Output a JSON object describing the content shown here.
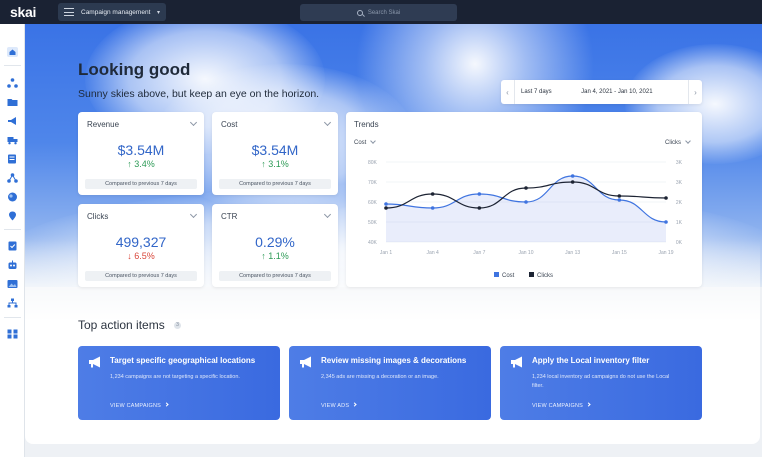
{
  "topbar": {
    "logo": "skai",
    "nav_label": "Campaign management",
    "search_placeholder": "Search Skai"
  },
  "hero": {
    "headline": "Looking good",
    "subhead": "Sunny skies above, but keep an eye on the horizon."
  },
  "datepicker": {
    "range_label": "Last 7 days",
    "dates": "Jan 4, 2021 - Jan 10, 2021"
  },
  "kpis": [
    {
      "title": "Revenue",
      "value": "$3.54M",
      "delta": "3.4%",
      "direction": "up",
      "footer": "Compared to previous 7 days"
    },
    {
      "title": "Cost",
      "value": "$3.54M",
      "delta": "3.1%",
      "direction": "up",
      "footer": "Compared to previous 7 days"
    },
    {
      "title": "Clicks",
      "value": "499,327",
      "delta": "6.5%",
      "direction": "down",
      "footer": "Compared to previous 7 days"
    },
    {
      "title": "CTR",
      "value": "0.29%",
      "delta": "1.1%",
      "direction": "up",
      "footer": "Compared to previous 7 days"
    }
  ],
  "trends": {
    "title": "Trends",
    "left_metric": "Cost",
    "right_metric": "Clicks"
  },
  "chart_data": {
    "type": "line",
    "x": [
      "Jan 1",
      "Jan 4",
      "Jan 7",
      "Jan 10",
      "Jan 13",
      "Jan 15",
      "Jan 19"
    ],
    "y_left_ticks": [
      "80K",
      "70K",
      "60K",
      "50K",
      "40K"
    ],
    "y_right_ticks": [
      "3K",
      "3K",
      "2K",
      "1K",
      "0K"
    ],
    "ylim_left": [
      40,
      80
    ],
    "series": [
      {
        "name": "Cost",
        "axis": "left",
        "color": "#3f74e0",
        "area": true,
        "values": [
          59,
          57,
          64,
          60,
          73,
          61,
          50
        ]
      },
      {
        "name": "Clicks",
        "axis": "left",
        "color": "#1c2333",
        "area": false,
        "values": [
          57,
          64,
          57,
          67,
          70,
          63,
          62
        ]
      }
    ],
    "legend_position": "bottom",
    "grid": true
  },
  "actions": {
    "title": "Top action items",
    "count": "3",
    "items": [
      {
        "title": "Target specific geographical locations",
        "desc": "1,234 campaigns are not targeting a specific location.",
        "link": "VIEW CAMPAIGNS"
      },
      {
        "title": "Review missing images & decorations",
        "desc": "2,345 ads are missing a decoration or an image.",
        "link": "VIEW ADS"
      },
      {
        "title": "Apply the Local inventory filter",
        "desc": "1,234 local inventory ad campaigns do not use the Local filter.",
        "link": "VIEW CAMPAIGNS"
      }
    ]
  },
  "colors": {
    "topbar": "#1a2233",
    "accent": "#3266c8",
    "up": "#2e9b57",
    "down": "#d9473b",
    "action_card": "#4474e3"
  }
}
